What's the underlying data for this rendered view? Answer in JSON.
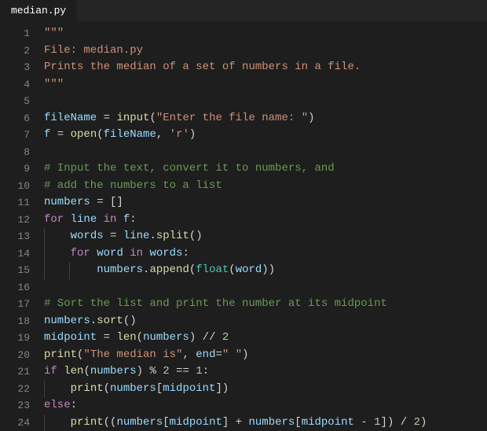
{
  "tab": {
    "filename": "median.py"
  },
  "code": {
    "lines": [
      {
        "n": 1,
        "indent": 0,
        "tokens": [
          [
            "str",
            "\"\"\""
          ]
        ]
      },
      {
        "n": 2,
        "indent": 0,
        "tokens": [
          [
            "str",
            "File: median.py"
          ]
        ]
      },
      {
        "n": 3,
        "indent": 0,
        "tokens": [
          [
            "str",
            "Prints the median of a set of numbers in a file."
          ]
        ]
      },
      {
        "n": 4,
        "indent": 0,
        "tokens": [
          [
            "str",
            "\"\"\""
          ]
        ]
      },
      {
        "n": 5,
        "indent": 0,
        "tokens": []
      },
      {
        "n": 6,
        "indent": 0,
        "tokens": [
          [
            "var",
            "fileName"
          ],
          [
            "op",
            " = "
          ],
          [
            "fn",
            "input"
          ],
          [
            "op",
            "("
          ],
          [
            "str",
            "\"Enter the file name: \""
          ],
          [
            "op",
            ")"
          ]
        ]
      },
      {
        "n": 7,
        "indent": 0,
        "tokens": [
          [
            "var",
            "f"
          ],
          [
            "op",
            " = "
          ],
          [
            "fn",
            "open"
          ],
          [
            "op",
            "("
          ],
          [
            "var",
            "fileName"
          ],
          [
            "op",
            ", "
          ],
          [
            "str",
            "'r'"
          ],
          [
            "op",
            ")"
          ]
        ]
      },
      {
        "n": 8,
        "indent": 0,
        "tokens": []
      },
      {
        "n": 9,
        "indent": 0,
        "tokens": [
          [
            "com",
            "# Input the text, convert it to numbers, and"
          ]
        ]
      },
      {
        "n": 10,
        "indent": 0,
        "tokens": [
          [
            "com",
            "# add the numbers to a list"
          ]
        ]
      },
      {
        "n": 11,
        "indent": 0,
        "tokens": [
          [
            "var",
            "numbers"
          ],
          [
            "op",
            " = []"
          ]
        ]
      },
      {
        "n": 12,
        "indent": 0,
        "tokens": [
          [
            "kw",
            "for"
          ],
          [
            "op",
            " "
          ],
          [
            "var",
            "line"
          ],
          [
            "op",
            " "
          ],
          [
            "kw",
            "in"
          ],
          [
            "op",
            " "
          ],
          [
            "var",
            "f"
          ],
          [
            "op",
            ":"
          ]
        ]
      },
      {
        "n": 13,
        "indent": 1,
        "tokens": [
          [
            "op",
            "    "
          ],
          [
            "var",
            "words"
          ],
          [
            "op",
            " = "
          ],
          [
            "var",
            "line"
          ],
          [
            "op",
            "."
          ],
          [
            "fn",
            "split"
          ],
          [
            "op",
            "()"
          ]
        ]
      },
      {
        "n": 14,
        "indent": 1,
        "tokens": [
          [
            "op",
            "    "
          ],
          [
            "kw",
            "for"
          ],
          [
            "op",
            " "
          ],
          [
            "var",
            "word"
          ],
          [
            "op",
            " "
          ],
          [
            "kw",
            "in"
          ],
          [
            "op",
            " "
          ],
          [
            "var",
            "words"
          ],
          [
            "op",
            ":"
          ]
        ]
      },
      {
        "n": 15,
        "indent": 2,
        "tokens": [
          [
            "op",
            "        "
          ],
          [
            "var",
            "numbers"
          ],
          [
            "op",
            "."
          ],
          [
            "fn",
            "append"
          ],
          [
            "op",
            "("
          ],
          [
            "builtin",
            "float"
          ],
          [
            "op",
            "("
          ],
          [
            "var",
            "word"
          ],
          [
            "op",
            "))"
          ]
        ]
      },
      {
        "n": 16,
        "indent": 0,
        "tokens": []
      },
      {
        "n": 17,
        "indent": 0,
        "tokens": [
          [
            "com",
            "# Sort the list and print the number at its midpoint"
          ]
        ]
      },
      {
        "n": 18,
        "indent": 0,
        "tokens": [
          [
            "var",
            "numbers"
          ],
          [
            "op",
            "."
          ],
          [
            "fn",
            "sort"
          ],
          [
            "op",
            "()"
          ]
        ]
      },
      {
        "n": 19,
        "indent": 0,
        "tokens": [
          [
            "var",
            "midpoint"
          ],
          [
            "op",
            " = "
          ],
          [
            "fn",
            "len"
          ],
          [
            "op",
            "("
          ],
          [
            "var",
            "numbers"
          ],
          [
            "op",
            ") // "
          ],
          [
            "num",
            "2"
          ]
        ]
      },
      {
        "n": 20,
        "indent": 0,
        "tokens": [
          [
            "fn",
            "print"
          ],
          [
            "op",
            "("
          ],
          [
            "str",
            "\"The median is\""
          ],
          [
            "op",
            ", "
          ],
          [
            "var",
            "end"
          ],
          [
            "op",
            "="
          ],
          [
            "str",
            "\" \""
          ],
          [
            "op",
            ")"
          ]
        ]
      },
      {
        "n": 21,
        "indent": 0,
        "tokens": [
          [
            "kw",
            "if"
          ],
          [
            "op",
            " "
          ],
          [
            "fn",
            "len"
          ],
          [
            "op",
            "("
          ],
          [
            "var",
            "numbers"
          ],
          [
            "op",
            ") % "
          ],
          [
            "num",
            "2"
          ],
          [
            "op",
            " == "
          ],
          [
            "num",
            "1"
          ],
          [
            "op",
            ":"
          ]
        ]
      },
      {
        "n": 22,
        "indent": 1,
        "tokens": [
          [
            "op",
            "    "
          ],
          [
            "fn",
            "print"
          ],
          [
            "op",
            "("
          ],
          [
            "var",
            "numbers"
          ],
          [
            "op",
            "["
          ],
          [
            "var",
            "midpoint"
          ],
          [
            "op",
            "])"
          ]
        ]
      },
      {
        "n": 23,
        "indent": 0,
        "tokens": [
          [
            "kw",
            "else"
          ],
          [
            "op",
            ":"
          ]
        ]
      },
      {
        "n": 24,
        "indent": 1,
        "tokens": [
          [
            "op",
            "    "
          ],
          [
            "fn",
            "print"
          ],
          [
            "op",
            "(("
          ],
          [
            "var",
            "numbers"
          ],
          [
            "op",
            "["
          ],
          [
            "var",
            "midpoint"
          ],
          [
            "op",
            "] + "
          ],
          [
            "var",
            "numbers"
          ],
          [
            "op",
            "["
          ],
          [
            "var",
            "midpoint"
          ],
          [
            "op",
            " - "
          ],
          [
            "num",
            "1"
          ],
          [
            "op",
            "]) / "
          ],
          [
            "num",
            "2"
          ],
          [
            "op",
            ")"
          ]
        ]
      }
    ]
  }
}
